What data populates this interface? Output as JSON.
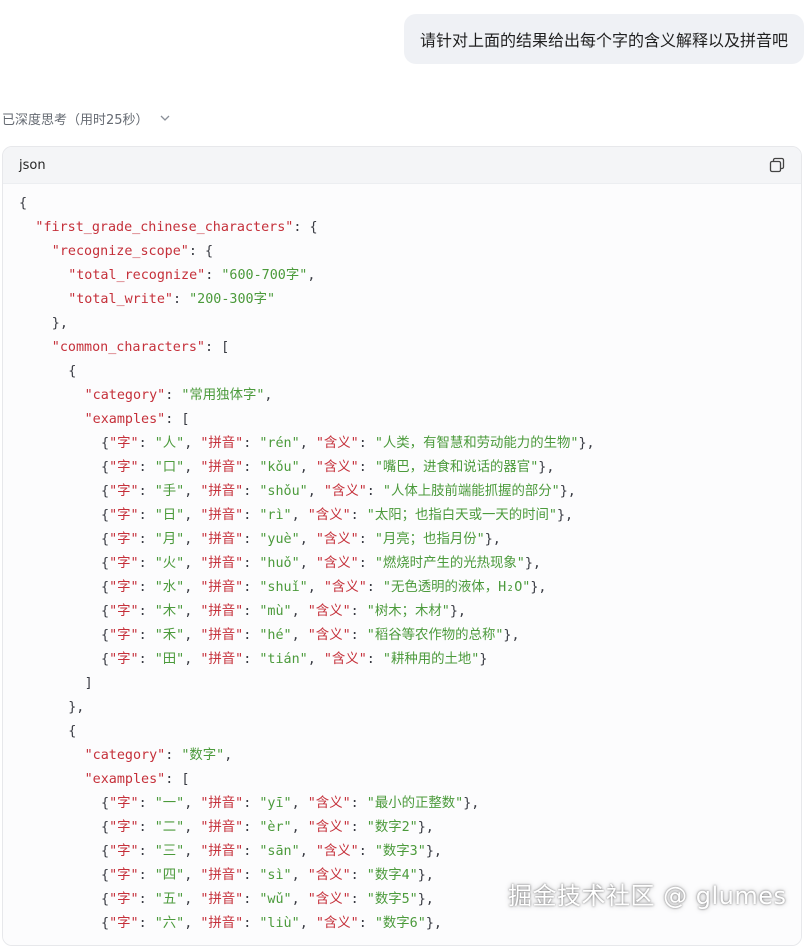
{
  "user_message": "请针对上面的结果给出每个字的含义解释以及拼音吧",
  "thought_status": "已深度思考（用时25秒）",
  "code_block": {
    "language": "json",
    "lines": [
      {
        "indent": 0,
        "parts": [
          {
            "t": "p",
            "v": "{"
          }
        ]
      },
      {
        "indent": 2,
        "parts": [
          {
            "t": "k",
            "v": "\"first_grade_chinese_characters\""
          },
          {
            "t": "p",
            "v": ": {"
          }
        ]
      },
      {
        "indent": 4,
        "parts": [
          {
            "t": "k",
            "v": "\"recognize_scope\""
          },
          {
            "t": "p",
            "v": ": {"
          }
        ]
      },
      {
        "indent": 6,
        "parts": [
          {
            "t": "k",
            "v": "\"total_recognize\""
          },
          {
            "t": "p",
            "v": ": "
          },
          {
            "t": "s",
            "v": "\"600-700字\""
          },
          {
            "t": "p",
            "v": ","
          }
        ]
      },
      {
        "indent": 6,
        "parts": [
          {
            "t": "k",
            "v": "\"total_write\""
          },
          {
            "t": "p",
            "v": ": "
          },
          {
            "t": "s",
            "v": "\"200-300字\""
          }
        ]
      },
      {
        "indent": 4,
        "parts": [
          {
            "t": "p",
            "v": "},"
          }
        ]
      },
      {
        "indent": 4,
        "parts": [
          {
            "t": "k",
            "v": "\"common_characters\""
          },
          {
            "t": "p",
            "v": ": ["
          }
        ]
      },
      {
        "indent": 6,
        "parts": [
          {
            "t": "p",
            "v": "{"
          }
        ]
      },
      {
        "indent": 8,
        "parts": [
          {
            "t": "k",
            "v": "\"category\""
          },
          {
            "t": "p",
            "v": ": "
          },
          {
            "t": "s",
            "v": "\"常用独体字\""
          },
          {
            "t": "p",
            "v": ","
          }
        ]
      },
      {
        "indent": 8,
        "parts": [
          {
            "t": "k",
            "v": "\"examples\""
          },
          {
            "t": "p",
            "v": ": ["
          }
        ]
      },
      {
        "indent": 10,
        "parts": [
          {
            "t": "p",
            "v": "{"
          },
          {
            "t": "k",
            "v": "\"字\""
          },
          {
            "t": "p",
            "v": ": "
          },
          {
            "t": "s",
            "v": "\"人\""
          },
          {
            "t": "p",
            "v": ", "
          },
          {
            "t": "k",
            "v": "\"拼音\""
          },
          {
            "t": "p",
            "v": ": "
          },
          {
            "t": "s",
            "v": "\"rén\""
          },
          {
            "t": "p",
            "v": ", "
          },
          {
            "t": "k",
            "v": "\"含义\""
          },
          {
            "t": "p",
            "v": ": "
          },
          {
            "t": "s",
            "v": "\"人类，有智慧和劳动能力的生物\""
          },
          {
            "t": "p",
            "v": "},"
          }
        ]
      },
      {
        "indent": 10,
        "parts": [
          {
            "t": "p",
            "v": "{"
          },
          {
            "t": "k",
            "v": "\"字\""
          },
          {
            "t": "p",
            "v": ": "
          },
          {
            "t": "s",
            "v": "\"口\""
          },
          {
            "t": "p",
            "v": ", "
          },
          {
            "t": "k",
            "v": "\"拼音\""
          },
          {
            "t": "p",
            "v": ": "
          },
          {
            "t": "s",
            "v": "\"kǒu\""
          },
          {
            "t": "p",
            "v": ", "
          },
          {
            "t": "k",
            "v": "\"含义\""
          },
          {
            "t": "p",
            "v": ": "
          },
          {
            "t": "s",
            "v": "\"嘴巴，进食和说话的器官\""
          },
          {
            "t": "p",
            "v": "},"
          }
        ]
      },
      {
        "indent": 10,
        "parts": [
          {
            "t": "p",
            "v": "{"
          },
          {
            "t": "k",
            "v": "\"字\""
          },
          {
            "t": "p",
            "v": ": "
          },
          {
            "t": "s",
            "v": "\"手\""
          },
          {
            "t": "p",
            "v": ", "
          },
          {
            "t": "k",
            "v": "\"拼音\""
          },
          {
            "t": "p",
            "v": ": "
          },
          {
            "t": "s",
            "v": "\"shǒu\""
          },
          {
            "t": "p",
            "v": ", "
          },
          {
            "t": "k",
            "v": "\"含义\""
          },
          {
            "t": "p",
            "v": ": "
          },
          {
            "t": "s",
            "v": "\"人体上肢前端能抓握的部分\""
          },
          {
            "t": "p",
            "v": "},"
          }
        ]
      },
      {
        "indent": 10,
        "parts": [
          {
            "t": "p",
            "v": "{"
          },
          {
            "t": "k",
            "v": "\"字\""
          },
          {
            "t": "p",
            "v": ": "
          },
          {
            "t": "s",
            "v": "\"日\""
          },
          {
            "t": "p",
            "v": ", "
          },
          {
            "t": "k",
            "v": "\"拼音\""
          },
          {
            "t": "p",
            "v": ": "
          },
          {
            "t": "s",
            "v": "\"rì\""
          },
          {
            "t": "p",
            "v": ", "
          },
          {
            "t": "k",
            "v": "\"含义\""
          },
          {
            "t": "p",
            "v": ": "
          },
          {
            "t": "s",
            "v": "\"太阳；也指白天或一天的时间\""
          },
          {
            "t": "p",
            "v": "},"
          }
        ]
      },
      {
        "indent": 10,
        "parts": [
          {
            "t": "p",
            "v": "{"
          },
          {
            "t": "k",
            "v": "\"字\""
          },
          {
            "t": "p",
            "v": ": "
          },
          {
            "t": "s",
            "v": "\"月\""
          },
          {
            "t": "p",
            "v": ", "
          },
          {
            "t": "k",
            "v": "\"拼音\""
          },
          {
            "t": "p",
            "v": ": "
          },
          {
            "t": "s",
            "v": "\"yuè\""
          },
          {
            "t": "p",
            "v": ", "
          },
          {
            "t": "k",
            "v": "\"含义\""
          },
          {
            "t": "p",
            "v": ": "
          },
          {
            "t": "s",
            "v": "\"月亮；也指月份\""
          },
          {
            "t": "p",
            "v": "},"
          }
        ]
      },
      {
        "indent": 10,
        "parts": [
          {
            "t": "p",
            "v": "{"
          },
          {
            "t": "k",
            "v": "\"字\""
          },
          {
            "t": "p",
            "v": ": "
          },
          {
            "t": "s",
            "v": "\"火\""
          },
          {
            "t": "p",
            "v": ", "
          },
          {
            "t": "k",
            "v": "\"拼音\""
          },
          {
            "t": "p",
            "v": ": "
          },
          {
            "t": "s",
            "v": "\"huǒ\""
          },
          {
            "t": "p",
            "v": ", "
          },
          {
            "t": "k",
            "v": "\"含义\""
          },
          {
            "t": "p",
            "v": ": "
          },
          {
            "t": "s",
            "v": "\"燃烧时产生的光热现象\""
          },
          {
            "t": "p",
            "v": "},"
          }
        ]
      },
      {
        "indent": 10,
        "parts": [
          {
            "t": "p",
            "v": "{"
          },
          {
            "t": "k",
            "v": "\"字\""
          },
          {
            "t": "p",
            "v": ": "
          },
          {
            "t": "s",
            "v": "\"水\""
          },
          {
            "t": "p",
            "v": ", "
          },
          {
            "t": "k",
            "v": "\"拼音\""
          },
          {
            "t": "p",
            "v": ": "
          },
          {
            "t": "s",
            "v": "\"shuǐ\""
          },
          {
            "t": "p",
            "v": ", "
          },
          {
            "t": "k",
            "v": "\"含义\""
          },
          {
            "t": "p",
            "v": ": "
          },
          {
            "t": "s",
            "v": "\"无色透明的液体，H₂O\""
          },
          {
            "t": "p",
            "v": "},"
          }
        ]
      },
      {
        "indent": 10,
        "parts": [
          {
            "t": "p",
            "v": "{"
          },
          {
            "t": "k",
            "v": "\"字\""
          },
          {
            "t": "p",
            "v": ": "
          },
          {
            "t": "s",
            "v": "\"木\""
          },
          {
            "t": "p",
            "v": ", "
          },
          {
            "t": "k",
            "v": "\"拼音\""
          },
          {
            "t": "p",
            "v": ": "
          },
          {
            "t": "s",
            "v": "\"mù\""
          },
          {
            "t": "p",
            "v": ", "
          },
          {
            "t": "k",
            "v": "\"含义\""
          },
          {
            "t": "p",
            "v": ": "
          },
          {
            "t": "s",
            "v": "\"树木；木材\""
          },
          {
            "t": "p",
            "v": "},"
          }
        ]
      },
      {
        "indent": 10,
        "parts": [
          {
            "t": "p",
            "v": "{"
          },
          {
            "t": "k",
            "v": "\"字\""
          },
          {
            "t": "p",
            "v": ": "
          },
          {
            "t": "s",
            "v": "\"禾\""
          },
          {
            "t": "p",
            "v": ", "
          },
          {
            "t": "k",
            "v": "\"拼音\""
          },
          {
            "t": "p",
            "v": ": "
          },
          {
            "t": "s",
            "v": "\"hé\""
          },
          {
            "t": "p",
            "v": ", "
          },
          {
            "t": "k",
            "v": "\"含义\""
          },
          {
            "t": "p",
            "v": ": "
          },
          {
            "t": "s",
            "v": "\"稻谷等农作物的总称\""
          },
          {
            "t": "p",
            "v": "},"
          }
        ]
      },
      {
        "indent": 10,
        "parts": [
          {
            "t": "p",
            "v": "{"
          },
          {
            "t": "k",
            "v": "\"字\""
          },
          {
            "t": "p",
            "v": ": "
          },
          {
            "t": "s",
            "v": "\"田\""
          },
          {
            "t": "p",
            "v": ", "
          },
          {
            "t": "k",
            "v": "\"拼音\""
          },
          {
            "t": "p",
            "v": ": "
          },
          {
            "t": "s",
            "v": "\"tián\""
          },
          {
            "t": "p",
            "v": ", "
          },
          {
            "t": "k",
            "v": "\"含义\""
          },
          {
            "t": "p",
            "v": ": "
          },
          {
            "t": "s",
            "v": "\"耕种用的土地\""
          },
          {
            "t": "p",
            "v": "}"
          }
        ]
      },
      {
        "indent": 8,
        "parts": [
          {
            "t": "p",
            "v": "]"
          }
        ]
      },
      {
        "indent": 6,
        "parts": [
          {
            "t": "p",
            "v": "},"
          }
        ]
      },
      {
        "indent": 6,
        "parts": [
          {
            "t": "p",
            "v": "{"
          }
        ]
      },
      {
        "indent": 8,
        "parts": [
          {
            "t": "k",
            "v": "\"category\""
          },
          {
            "t": "p",
            "v": ": "
          },
          {
            "t": "s",
            "v": "\"数字\""
          },
          {
            "t": "p",
            "v": ","
          }
        ]
      },
      {
        "indent": 8,
        "parts": [
          {
            "t": "k",
            "v": "\"examples\""
          },
          {
            "t": "p",
            "v": ": ["
          }
        ]
      },
      {
        "indent": 10,
        "parts": [
          {
            "t": "p",
            "v": "{"
          },
          {
            "t": "k",
            "v": "\"字\""
          },
          {
            "t": "p",
            "v": ": "
          },
          {
            "t": "s",
            "v": "\"一\""
          },
          {
            "t": "p",
            "v": ", "
          },
          {
            "t": "k",
            "v": "\"拼音\""
          },
          {
            "t": "p",
            "v": ": "
          },
          {
            "t": "s",
            "v": "\"yī\""
          },
          {
            "t": "p",
            "v": ", "
          },
          {
            "t": "k",
            "v": "\"含义\""
          },
          {
            "t": "p",
            "v": ": "
          },
          {
            "t": "s",
            "v": "\"最小的正整数\""
          },
          {
            "t": "p",
            "v": "},"
          }
        ]
      },
      {
        "indent": 10,
        "parts": [
          {
            "t": "p",
            "v": "{"
          },
          {
            "t": "k",
            "v": "\"字\""
          },
          {
            "t": "p",
            "v": ": "
          },
          {
            "t": "s",
            "v": "\"二\""
          },
          {
            "t": "p",
            "v": ", "
          },
          {
            "t": "k",
            "v": "\"拼音\""
          },
          {
            "t": "p",
            "v": ": "
          },
          {
            "t": "s",
            "v": "\"èr\""
          },
          {
            "t": "p",
            "v": ", "
          },
          {
            "t": "k",
            "v": "\"含义\""
          },
          {
            "t": "p",
            "v": ": "
          },
          {
            "t": "s",
            "v": "\"数字2\""
          },
          {
            "t": "p",
            "v": "},"
          }
        ]
      },
      {
        "indent": 10,
        "parts": [
          {
            "t": "p",
            "v": "{"
          },
          {
            "t": "k",
            "v": "\"字\""
          },
          {
            "t": "p",
            "v": ": "
          },
          {
            "t": "s",
            "v": "\"三\""
          },
          {
            "t": "p",
            "v": ", "
          },
          {
            "t": "k",
            "v": "\"拼音\""
          },
          {
            "t": "p",
            "v": ": "
          },
          {
            "t": "s",
            "v": "\"sān\""
          },
          {
            "t": "p",
            "v": ", "
          },
          {
            "t": "k",
            "v": "\"含义\""
          },
          {
            "t": "p",
            "v": ": "
          },
          {
            "t": "s",
            "v": "\"数字3\""
          },
          {
            "t": "p",
            "v": "},"
          }
        ]
      },
      {
        "indent": 10,
        "parts": [
          {
            "t": "p",
            "v": "{"
          },
          {
            "t": "k",
            "v": "\"字\""
          },
          {
            "t": "p",
            "v": ": "
          },
          {
            "t": "s",
            "v": "\"四\""
          },
          {
            "t": "p",
            "v": ", "
          },
          {
            "t": "k",
            "v": "\"拼音\""
          },
          {
            "t": "p",
            "v": ": "
          },
          {
            "t": "s",
            "v": "\"sì\""
          },
          {
            "t": "p",
            "v": ", "
          },
          {
            "t": "k",
            "v": "\"含义\""
          },
          {
            "t": "p",
            "v": ": "
          },
          {
            "t": "s",
            "v": "\"数字4\""
          },
          {
            "t": "p",
            "v": "},"
          }
        ]
      },
      {
        "indent": 10,
        "parts": [
          {
            "t": "p",
            "v": "{"
          },
          {
            "t": "k",
            "v": "\"字\""
          },
          {
            "t": "p",
            "v": ": "
          },
          {
            "t": "s",
            "v": "\"五\""
          },
          {
            "t": "p",
            "v": ", "
          },
          {
            "t": "k",
            "v": "\"拼音\""
          },
          {
            "t": "p",
            "v": ": "
          },
          {
            "t": "s",
            "v": "\"wǔ\""
          },
          {
            "t": "p",
            "v": ", "
          },
          {
            "t": "k",
            "v": "\"含义\""
          },
          {
            "t": "p",
            "v": ": "
          },
          {
            "t": "s",
            "v": "\"数字5\""
          },
          {
            "t": "p",
            "v": "},"
          }
        ]
      },
      {
        "indent": 10,
        "parts": [
          {
            "t": "p",
            "v": "{"
          },
          {
            "t": "k",
            "v": "\"字\""
          },
          {
            "t": "p",
            "v": ": "
          },
          {
            "t": "s",
            "v": "\"六\""
          },
          {
            "t": "p",
            "v": ", "
          },
          {
            "t": "k",
            "v": "\"拼音\""
          },
          {
            "t": "p",
            "v": ": "
          },
          {
            "t": "s",
            "v": "\"liù\""
          },
          {
            "t": "p",
            "v": ", "
          },
          {
            "t": "k",
            "v": "\"含义\""
          },
          {
            "t": "p",
            "v": ": "
          },
          {
            "t": "s",
            "v": "\"数字6\""
          },
          {
            "t": "p",
            "v": "},"
          }
        ]
      }
    ]
  },
  "watermark": "掘金技术社区 @ glumes",
  "icons": {
    "expand": "chevron-down-icon",
    "copy": "copy-icon"
  },
  "colors": {
    "key": "#c5303a",
    "string": "#4b9a3b",
    "punct": "#383a42",
    "bubble": "#eff1f5"
  }
}
